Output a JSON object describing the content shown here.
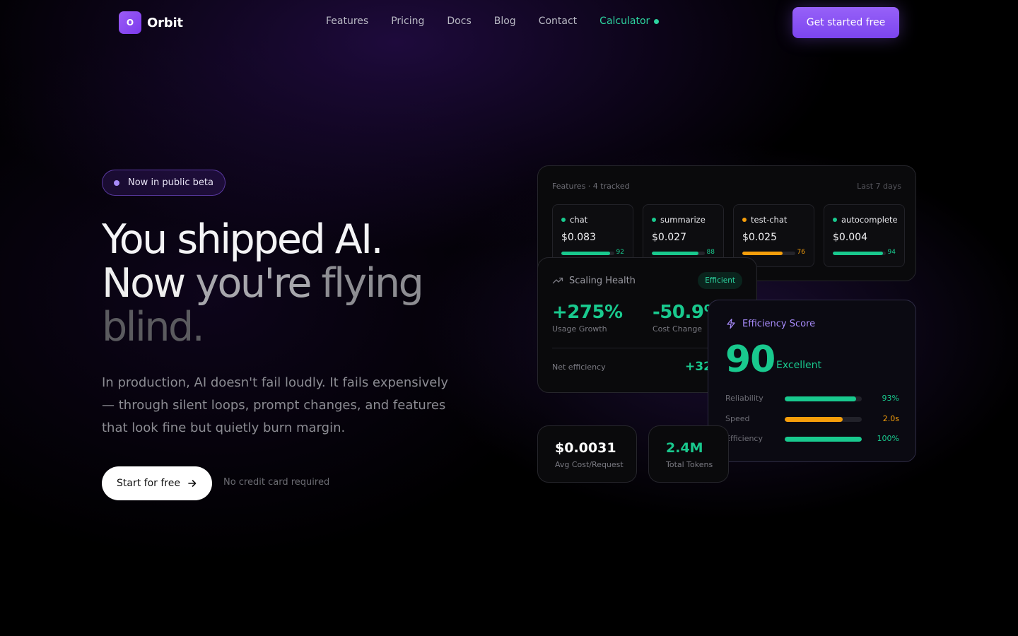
{
  "brand": {
    "logo_letter": "O",
    "name": "Orbit"
  },
  "nav": {
    "links": [
      "Features",
      "Pricing",
      "Docs",
      "Blog",
      "Contact"
    ],
    "calculator": "Calculator",
    "cta": "Get started free"
  },
  "hero": {
    "badge": "Now in public beta",
    "headline": {
      "line1": "You shipped AI.",
      "line2_a": "Now",
      "line2_b": "you're",
      "line2_c": "flying",
      "line3": "blind."
    },
    "subcopy": "In production, AI doesn't fail loudly. It fails expensively — through silent loops, prompt changes, and features that look fine but quietly burn margin.",
    "start_button": "Start for free",
    "note": "No credit card required"
  },
  "features_card": {
    "title": "Features · 4 tracked",
    "range": "Last 7 days",
    "items": [
      {
        "name": "chat",
        "cost": "$0.083",
        "score": "92",
        "level": 0.92,
        "color": "#19c98e"
      },
      {
        "name": "summarize",
        "cost": "$0.027",
        "score": "88",
        "level": 0.88,
        "color": "#19c98e"
      },
      {
        "name": "test-chat",
        "cost": "$0.025",
        "score": "76",
        "level": 0.76,
        "color": "#f59e0b"
      },
      {
        "name": "autocomplete",
        "cost": "$0.004",
        "score": "94",
        "level": 0.94,
        "color": "#19c98e"
      }
    ]
  },
  "scaling_card": {
    "title": "Scaling Health",
    "badge": "Efficient",
    "usage_growth": {
      "value": "+275%",
      "label": "Usage Growth"
    },
    "cost_change": {
      "value": "-50.9%",
      "label": "Cost Change"
    },
    "net_label": "Net efficiency",
    "net_value": "+32"
  },
  "efficiency_card": {
    "title": "Efficiency Score",
    "score": "90",
    "rating": "Excellent",
    "rows": [
      {
        "label": "Reliability",
        "value": "93%",
        "level": 0.93,
        "color": "#19c98e"
      },
      {
        "label": "Speed",
        "value": "2.0s",
        "level": 0.75,
        "color": "#f59e0b"
      },
      {
        "label": "Efficiency",
        "value": "100%",
        "level": 1.0,
        "color": "#19c98e"
      }
    ]
  },
  "stats": [
    {
      "value": "$0.0031",
      "label": "Avg Cost/Request",
      "color": "#ffffff"
    },
    {
      "value": "2.4M",
      "label": "Total Tokens",
      "color": "#19c98e"
    }
  ]
}
